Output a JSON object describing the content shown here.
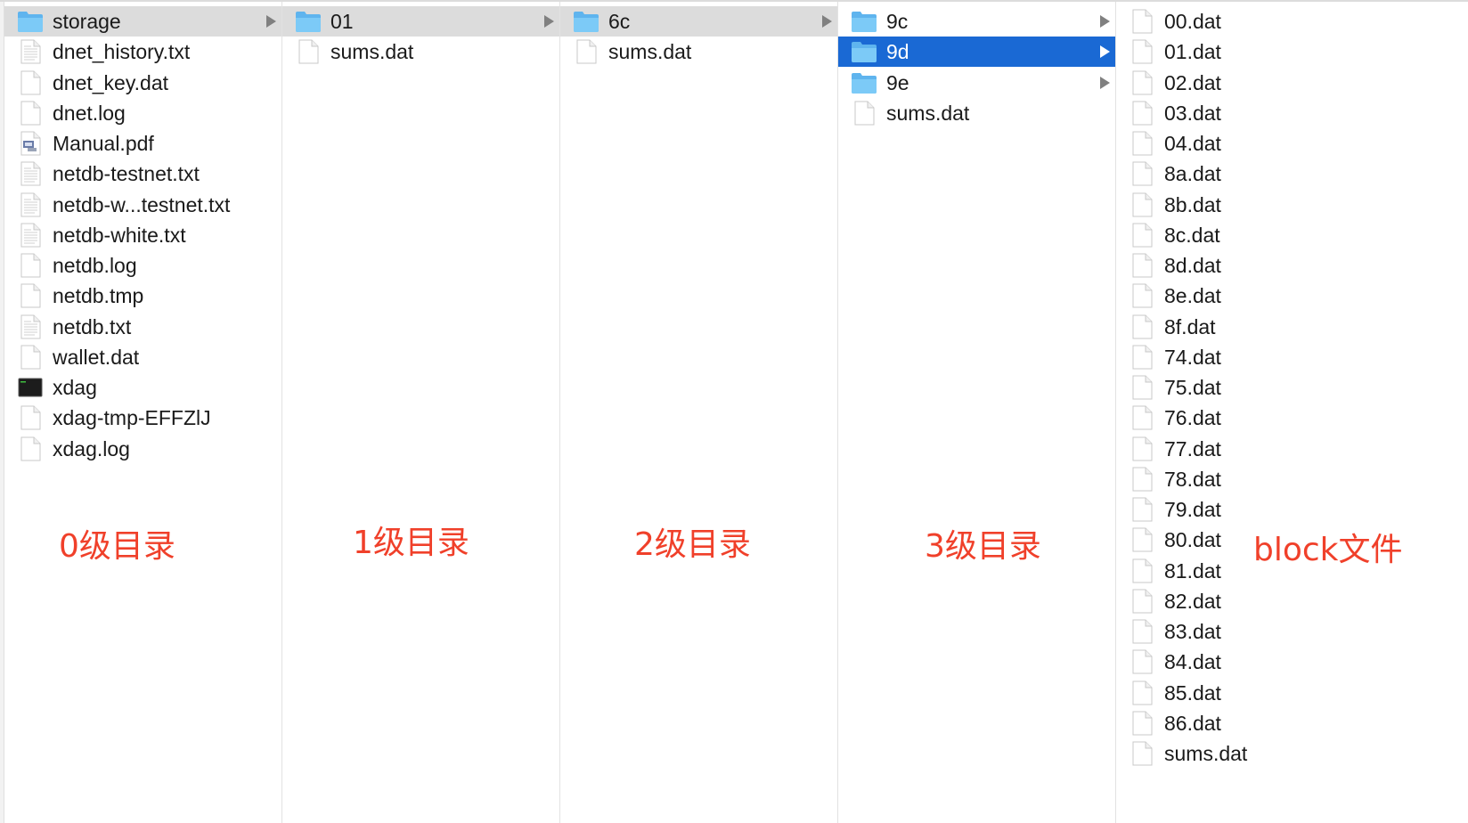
{
  "columns": [
    {
      "items": [
        {
          "name": "storage",
          "type": "folder",
          "state": "path"
        },
        {
          "name": "dnet_history.txt",
          "type": "text"
        },
        {
          "name": "dnet_key.dat",
          "type": "file"
        },
        {
          "name": "dnet.log",
          "type": "file"
        },
        {
          "name": "Manual.pdf",
          "type": "pdf"
        },
        {
          "name": "netdb-testnet.txt",
          "type": "text"
        },
        {
          "name": "netdb-w...testnet.txt",
          "type": "text"
        },
        {
          "name": "netdb-white.txt",
          "type": "text"
        },
        {
          "name": "netdb.log",
          "type": "file"
        },
        {
          "name": "netdb.tmp",
          "type": "file"
        },
        {
          "name": "netdb.txt",
          "type": "text"
        },
        {
          "name": "wallet.dat",
          "type": "file"
        },
        {
          "name": "xdag",
          "type": "exec"
        },
        {
          "name": "xdag-tmp-EFFZlJ",
          "type": "file"
        },
        {
          "name": "xdag.log",
          "type": "file"
        }
      ]
    },
    {
      "items": [
        {
          "name": "01",
          "type": "folder",
          "state": "path"
        },
        {
          "name": "sums.dat",
          "type": "file"
        }
      ]
    },
    {
      "items": [
        {
          "name": "6c",
          "type": "folder",
          "state": "path"
        },
        {
          "name": "sums.dat",
          "type": "file"
        }
      ]
    },
    {
      "items": [
        {
          "name": "9c",
          "type": "folder"
        },
        {
          "name": "9d",
          "type": "folder",
          "state": "selected"
        },
        {
          "name": "9e",
          "type": "folder"
        },
        {
          "name": "sums.dat",
          "type": "file"
        }
      ]
    },
    {
      "items": [
        {
          "name": "00.dat",
          "type": "file"
        },
        {
          "name": "01.dat",
          "type": "file"
        },
        {
          "name": "02.dat",
          "type": "file"
        },
        {
          "name": "03.dat",
          "type": "file"
        },
        {
          "name": "04.dat",
          "type": "file"
        },
        {
          "name": "8a.dat",
          "type": "file"
        },
        {
          "name": "8b.dat",
          "type": "file"
        },
        {
          "name": "8c.dat",
          "type": "file"
        },
        {
          "name": "8d.dat",
          "type": "file"
        },
        {
          "name": "8e.dat",
          "type": "file"
        },
        {
          "name": "8f.dat",
          "type": "file"
        },
        {
          "name": "74.dat",
          "type": "file"
        },
        {
          "name": "75.dat",
          "type": "file"
        },
        {
          "name": "76.dat",
          "type": "file"
        },
        {
          "name": "77.dat",
          "type": "file"
        },
        {
          "name": "78.dat",
          "type": "file"
        },
        {
          "name": "79.dat",
          "type": "file"
        },
        {
          "name": "80.dat",
          "type": "file"
        },
        {
          "name": "81.dat",
          "type": "file"
        },
        {
          "name": "82.dat",
          "type": "file"
        },
        {
          "name": "83.dat",
          "type": "file"
        },
        {
          "name": "84.dat",
          "type": "file"
        },
        {
          "name": "85.dat",
          "type": "file"
        },
        {
          "name": "86.dat",
          "type": "file"
        },
        {
          "name": "sums.dat",
          "type": "file"
        }
      ]
    }
  ],
  "annotations": {
    "level0": "0级目录",
    "level1": "1级目录",
    "level2": "2级目录",
    "level3": "3级目录",
    "block": "block文件"
  },
  "colors": {
    "selection": "#1a69d4",
    "path_highlight": "#dcdcdc",
    "annotation": "#f0402a",
    "folder": "#6cc0f5"
  }
}
